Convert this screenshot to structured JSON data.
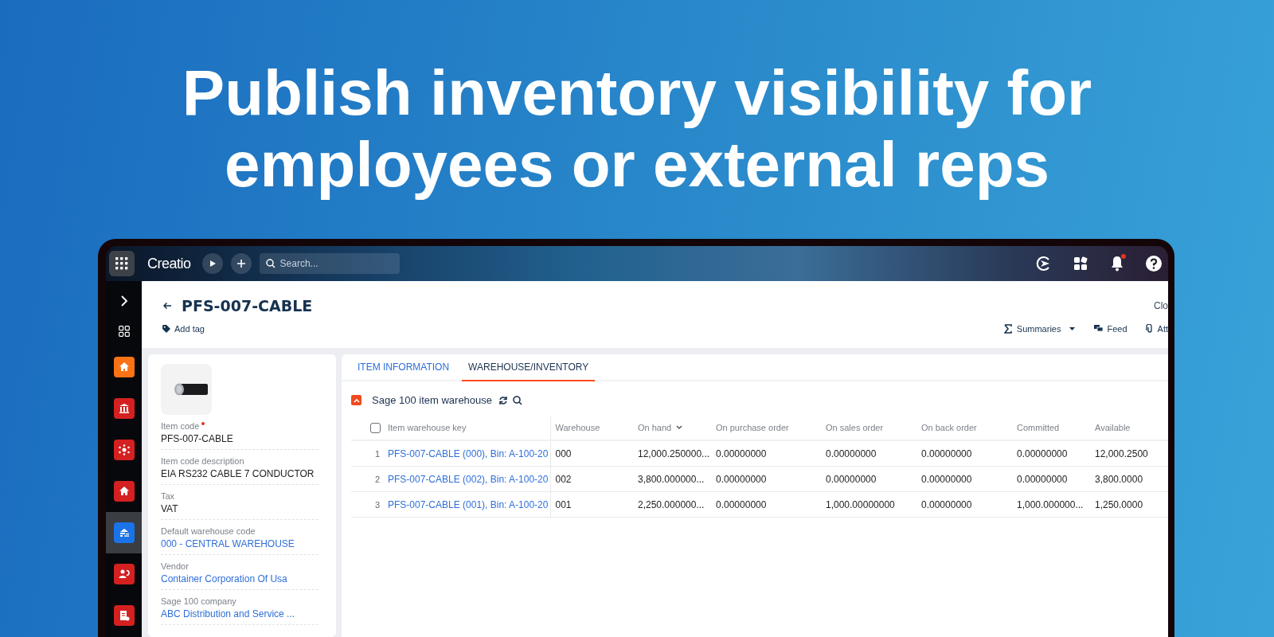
{
  "headline": "Publish inventory visibility for employees or external reps",
  "topbar": {
    "logo": "Creatio",
    "search": {
      "placeholder": "Search..."
    },
    "notifications_unread": true
  },
  "sidebar": {
    "items": [
      {
        "kind": "expand",
        "selected": false
      },
      {
        "kind": "apps",
        "selected": false
      },
      {
        "kind": "home",
        "color": "#f97316",
        "selected": false
      },
      {
        "kind": "bank",
        "color": "#d42020",
        "selected": false
      },
      {
        "kind": "network",
        "color": "#d42020",
        "selected": false
      },
      {
        "kind": "home",
        "color": "#d42020",
        "selected": false
      },
      {
        "kind": "warehouse",
        "color": "#1a73e8",
        "selected": true
      },
      {
        "kind": "people",
        "color": "#d42020",
        "selected": false
      },
      {
        "kind": "report",
        "color": "#d42020",
        "selected": false
      }
    ]
  },
  "page": {
    "title": "PFS-007-CABLE",
    "add_tag": "Add tag",
    "close": "Clo",
    "actions": [
      {
        "kind": "summaries",
        "label": "Summaries"
      },
      {
        "kind": "feed",
        "label": "Feed"
      },
      {
        "kind": "attach",
        "label": "Att"
      }
    ]
  },
  "fields": [
    {
      "label": "Item code",
      "value": "PFS-007-CABLE",
      "required": true,
      "link": false
    },
    {
      "label": "Item code description",
      "value": "EIA RS232 CABLE 7 CONDUCTOR",
      "required": false,
      "link": false
    },
    {
      "label": "Tax",
      "value": "VAT",
      "required": false,
      "link": false
    },
    {
      "label": "Default warehouse code",
      "value": "000 - CENTRAL WAREHOUSE",
      "required": false,
      "link": true
    },
    {
      "label": "Vendor",
      "value": "Container Corporation Of Usa",
      "required": false,
      "link": true
    },
    {
      "label": "Sage 100 company",
      "value": "ABC Distribution and Service ...",
      "required": false,
      "link": true
    }
  ],
  "tabs": [
    {
      "label": "ITEM INFORMATION",
      "selected": false
    },
    {
      "label": "WAREHOUSE/INVENTORY",
      "selected": true
    }
  ],
  "detail": {
    "title": "Sage 100 item warehouse",
    "expanded": true
  },
  "table": {
    "all_checked": false,
    "columns": [
      {
        "label": "Item warehouse key",
        "sorted": false
      },
      {
        "label": "Warehouse",
        "sorted": false
      },
      {
        "label": "On hand",
        "sorted": true
      },
      {
        "label": "On purchase order",
        "sorted": false
      },
      {
        "label": "On sales order",
        "sorted": false
      },
      {
        "label": "On back order",
        "sorted": false
      },
      {
        "label": "Committed",
        "sorted": false
      },
      {
        "label": "Available",
        "sorted": false
      }
    ],
    "rows": [
      {
        "number": "1",
        "cells": [
          "PFS-007-CABLE (000), Bin: A-100-20",
          "000",
          "12,000.250000...",
          "0.00000000",
          "0.00000000",
          "0.00000000",
          "0.00000000",
          "12,000.2500"
        ]
      },
      {
        "number": "2",
        "cells": [
          "PFS-007-CABLE (002), Bin: A-100-20",
          "002",
          "3,800.000000...",
          "0.00000000",
          "0.00000000",
          "0.00000000",
          "0.00000000",
          "3,800.0000"
        ]
      },
      {
        "number": "3",
        "cells": [
          "PFS-007-CABLE (001), Bin: A-100-20",
          "001",
          "2,250.000000...",
          "0.00000000",
          "1,000.00000000",
          "0.00000000",
          "1,000.000000...",
          "1,250.0000"
        ]
      }
    ]
  }
}
